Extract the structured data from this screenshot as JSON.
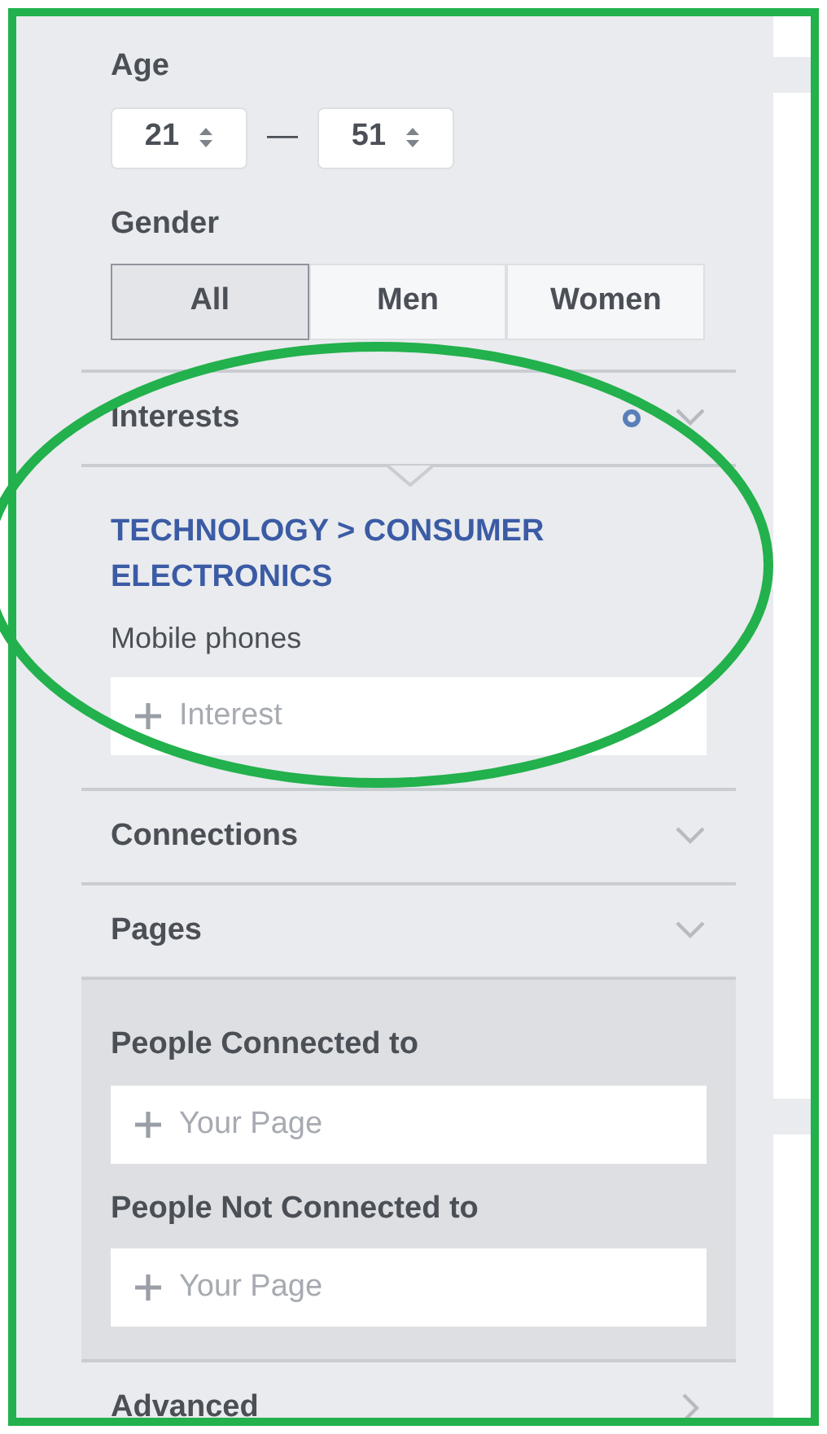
{
  "age": {
    "label": "Age",
    "min": "21",
    "max": "51",
    "separator": "—"
  },
  "gender": {
    "label": "Gender",
    "options": [
      {
        "label": "All",
        "selected": true
      },
      {
        "label": "Men",
        "selected": false
      },
      {
        "label": "Women",
        "selected": false
      }
    ]
  },
  "sections": [
    {
      "kind": "interests",
      "title": "Interests",
      "expanded": true,
      "breadcrumb": "TECHNOLOGY > CONSUMER ELECTRONICS",
      "items": [
        "Mobile phones"
      ],
      "placeholder": "Interest"
    },
    {
      "kind": "plain",
      "title": "Connections",
      "expanded": false
    },
    {
      "kind": "pages",
      "title": "Pages",
      "expanded": true,
      "groups": [
        {
          "label": "People Connected to",
          "placeholder": "Your Page"
        },
        {
          "label": "People Not Connected to",
          "placeholder": "Your Page"
        }
      ]
    },
    {
      "kind": "link",
      "title": "Advanced",
      "expanded": false
    }
  ]
}
